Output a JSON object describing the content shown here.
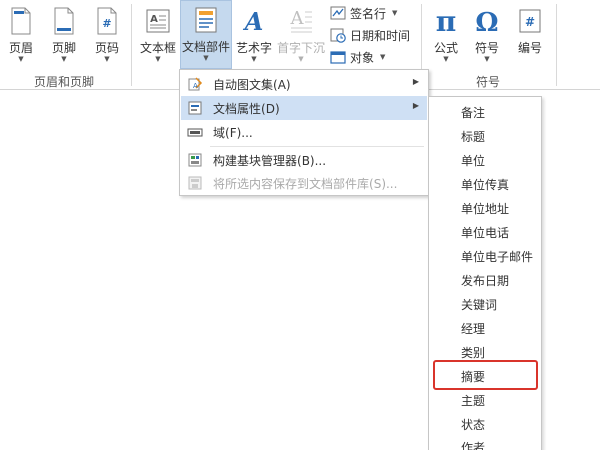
{
  "ribbon": {
    "buttons": [
      {
        "label": "页眉",
        "icon": "header-icon"
      },
      {
        "label": "页脚",
        "icon": "footer-icon"
      },
      {
        "label": "页码",
        "icon": "page-number-icon"
      },
      {
        "label": "文本框",
        "icon": "text-box-icon"
      },
      {
        "label": "文档部件",
        "icon": "quick-parts-icon"
      },
      {
        "label": "艺术字",
        "icon": "wordart-icon"
      },
      {
        "label": "首字下沉",
        "icon": "drop-cap-icon"
      },
      {
        "label": "公式",
        "icon": "equation-icon"
      },
      {
        "label": "符号",
        "icon": "symbol-icon"
      },
      {
        "label": "编号",
        "icon": "numbering-icon"
      }
    ],
    "small_buttons": [
      {
        "label": "签名行",
        "icon": "signature-line-icon"
      },
      {
        "label": "日期和时间",
        "icon": "date-time-icon"
      },
      {
        "label": "对象",
        "icon": "object-icon"
      }
    ],
    "groups": {
      "header_footer": "页眉和页脚",
      "symbols": "符号"
    }
  },
  "menu": {
    "items": [
      {
        "label": "自动图文集",
        "key": "(A)",
        "icon": "autotext-icon",
        "submenu": "▶"
      },
      {
        "label": "文档属性",
        "key": "(D)",
        "icon": "document-property-icon",
        "submenu": "▶"
      },
      {
        "label": "域",
        "key": "(F)...",
        "icon": "field-icon"
      },
      {
        "label": "构建基块管理器",
        "key": "(B)...",
        "icon": "building-blocks-icon"
      },
      {
        "label": "将所选内容保存到文档部件库",
        "key": "(S)...",
        "icon": "save-selection-icon"
      }
    ]
  },
  "submenu": {
    "items": [
      "备注",
      "标题",
      "单位",
      "单位传真",
      "单位地址",
      "单位电话",
      "单位电子邮件",
      "发布日期",
      "关键词",
      "经理",
      "类别",
      "摘要",
      "主题",
      "状态",
      "作者"
    ]
  },
  "colors": {
    "accent_blue": "#2b6cb5",
    "menu_hover": "#cfe0f4",
    "active_button": "#c5d9ee",
    "highlight_red": "#d9342b"
  }
}
